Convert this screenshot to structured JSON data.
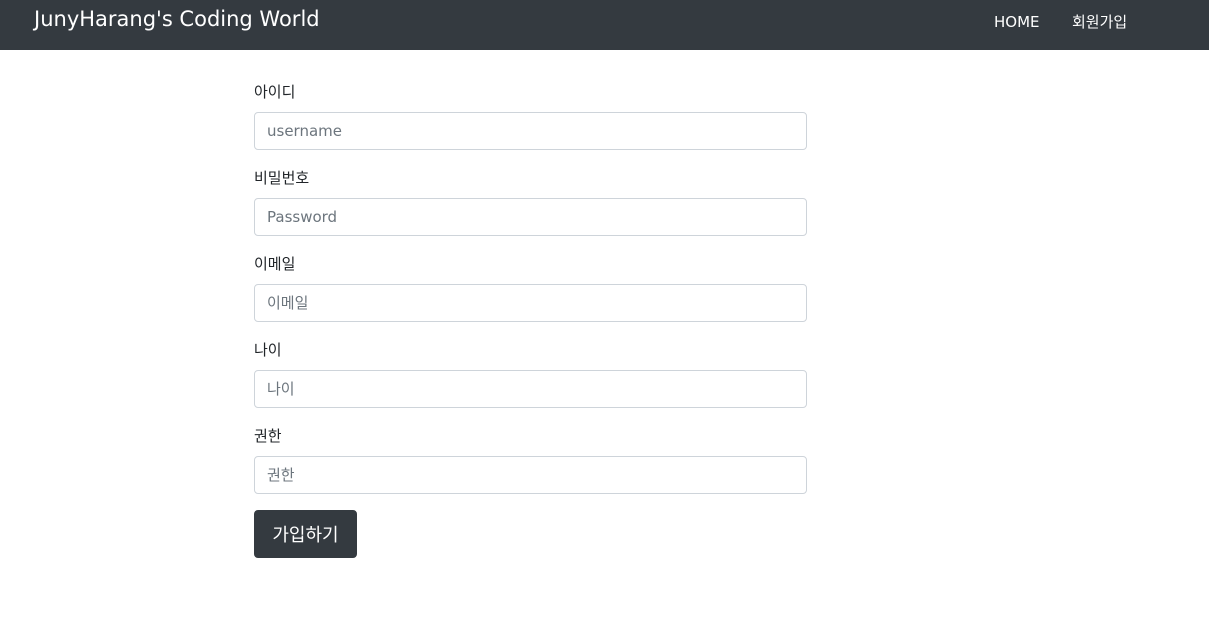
{
  "navbar": {
    "brand": "JunyHarang's Coding World",
    "links": [
      {
        "label": "HOME"
      },
      {
        "label": "회원가입"
      }
    ]
  },
  "form": {
    "fields": [
      {
        "label": "아이디",
        "placeholder": "username",
        "value": ""
      },
      {
        "label": "비밀번호",
        "placeholder": "Password",
        "value": ""
      },
      {
        "label": "이메일",
        "placeholder": "이메일",
        "value": ""
      },
      {
        "label": "나이",
        "placeholder": "나이",
        "value": ""
      },
      {
        "label": "권한",
        "placeholder": "권한",
        "value": ""
      }
    ],
    "submit_label": "가입하기"
  },
  "colors": {
    "navbar_bg": "#343a40",
    "button_bg": "#343a40",
    "input_border": "#ced4da"
  }
}
